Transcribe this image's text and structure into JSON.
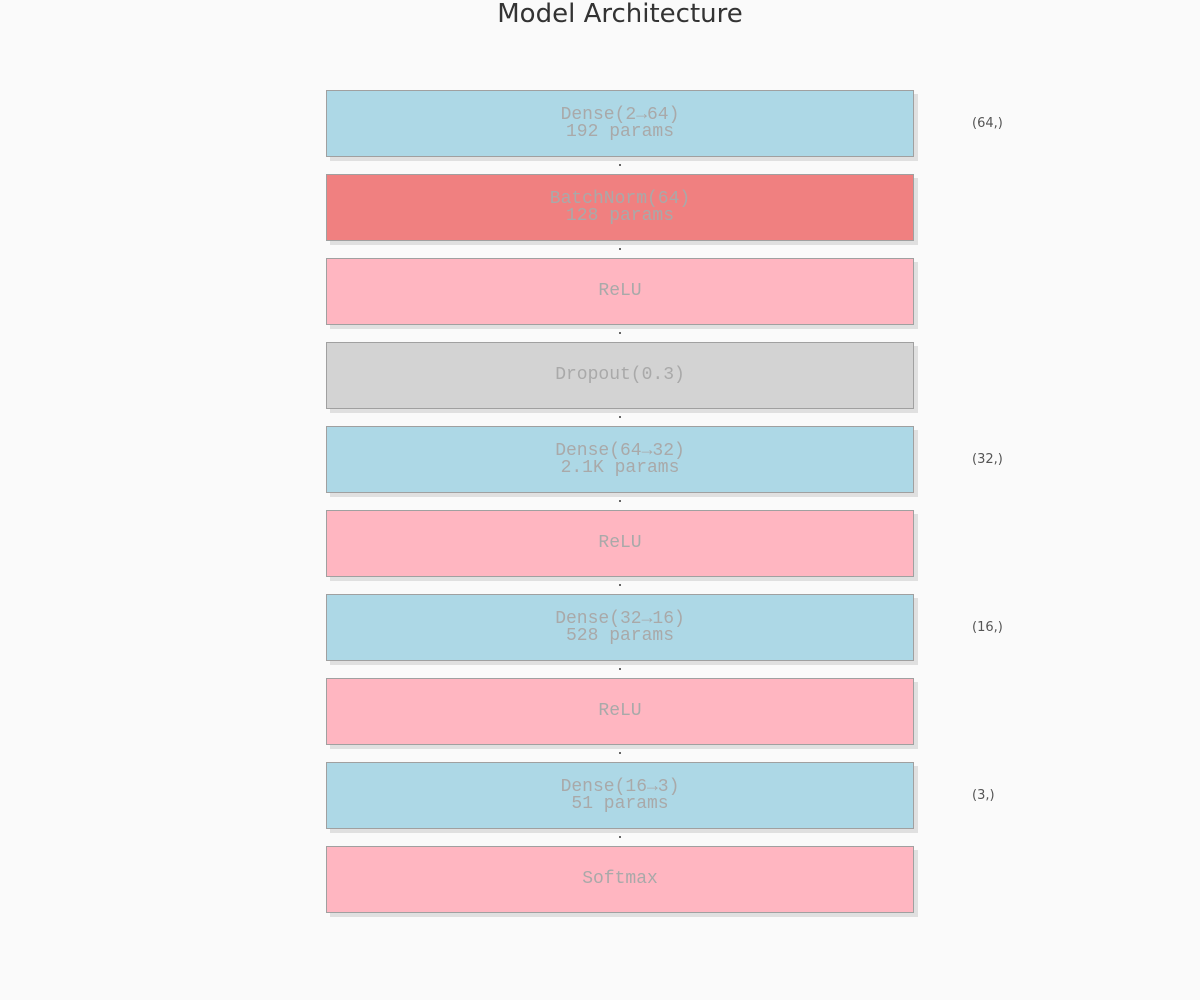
{
  "title": "Model Architecture",
  "colors": {
    "dense": "#add8e6",
    "batchnorm": "#f08080",
    "activation": "#ffb6c1",
    "dropout": "#d3d3d3",
    "border": "#a0a0a0",
    "text": "#a9a9a9"
  },
  "layers": [
    {
      "type": "dense",
      "label": "Dense(2→64)",
      "params": "192 params",
      "output_shape": "(64,)"
    },
    {
      "type": "batchnorm",
      "label": "BatchNorm(64)",
      "params": "128 params",
      "output_shape": ""
    },
    {
      "type": "activation",
      "label": "ReLU",
      "params": "",
      "output_shape": ""
    },
    {
      "type": "dropout",
      "label": "Dropout(0.3)",
      "params": "",
      "output_shape": ""
    },
    {
      "type": "dense",
      "label": "Dense(64→32)",
      "params": "2.1K params",
      "output_shape": "(32,)"
    },
    {
      "type": "activation",
      "label": "ReLU",
      "params": "",
      "output_shape": ""
    },
    {
      "type": "dense",
      "label": "Dense(32→16)",
      "params": "528 params",
      "output_shape": "(16,)"
    },
    {
      "type": "activation",
      "label": "ReLU",
      "params": "",
      "output_shape": ""
    },
    {
      "type": "dense",
      "label": "Dense(16→3)",
      "params": "51 params",
      "output_shape": "(3,)"
    },
    {
      "type": "activation",
      "label": "Softmax",
      "params": "",
      "output_shape": ""
    }
  ]
}
